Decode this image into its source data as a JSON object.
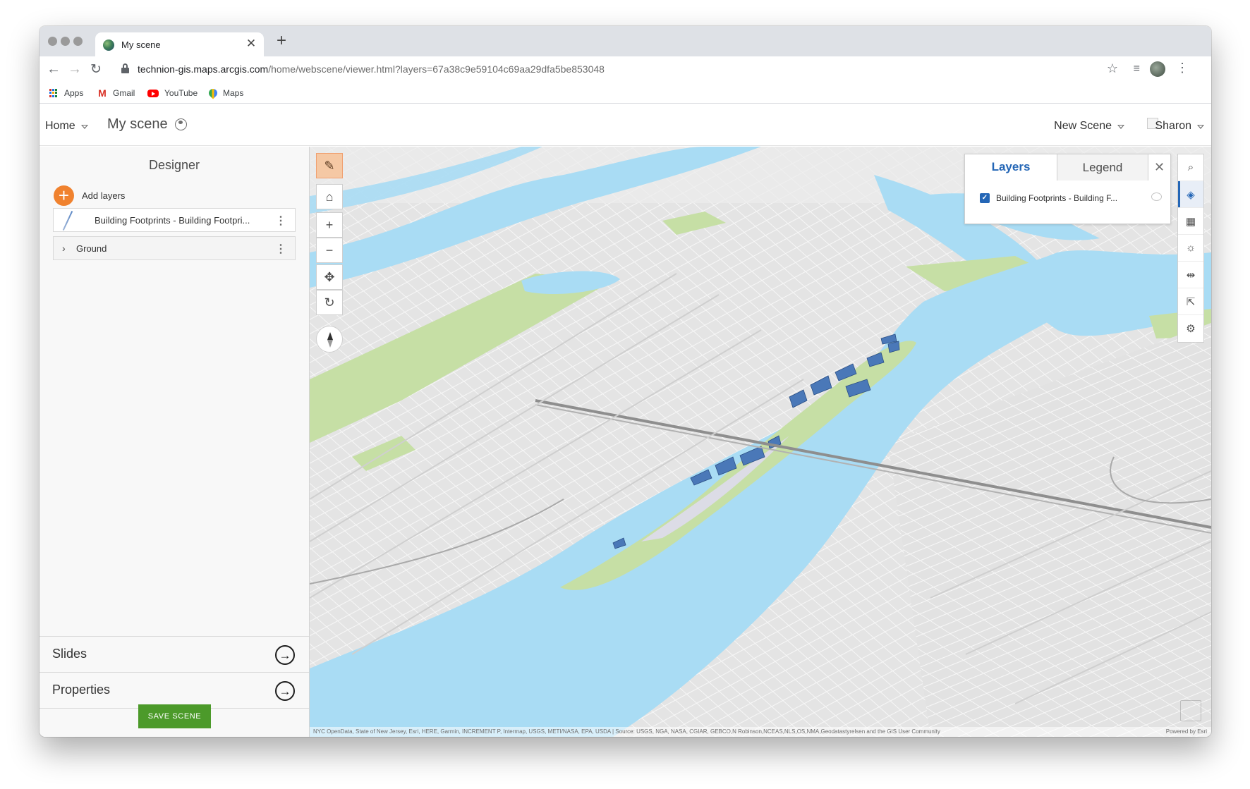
{
  "browser": {
    "tab_title": "My scene",
    "url_host": "technion-gis.maps.arcgis.com",
    "url_path": "/home/webscene/viewer.html?layers=67a38c9e59104c69aa29dfa5be853048",
    "bookmarks": [
      {
        "label": "Apps",
        "icon": "apps-grid-icon"
      },
      {
        "label": "Gmail",
        "icon": "gmail-icon"
      },
      {
        "label": "YouTube",
        "icon": "youtube-icon"
      },
      {
        "label": "Maps",
        "icon": "google-maps-icon"
      }
    ]
  },
  "header": {
    "home_label": "Home",
    "scene_title": "My scene",
    "new_scene_label": "New Scene",
    "user_name": "Sharon"
  },
  "designer": {
    "title": "Designer",
    "add_layers_label": "Add layers",
    "layers": [
      {
        "label": "Building Footprints - Building Footpri..."
      },
      {
        "label": "Ground"
      }
    ],
    "sections": [
      {
        "label": "Slides"
      },
      {
        "label": "Properties"
      }
    ],
    "save_label": "SAVE SCENE"
  },
  "map": {
    "layers_panel": {
      "tab_layers": "Layers",
      "tab_legend": "Legend",
      "item_label": "Building Footprints - Building F...",
      "item_checked": true
    },
    "attribution": "NYC OpenData, State of New Jersey, Esri, HERE, Garmin, INCREMENT P, Intermap, USGS, METI/NASA, EPA, USDA | Source: USGS, NGA, NASA, CGIAR, GEBCO,N Robinson,NCEAS,NLS,OS,NMA,Geodatastyrelsen and the GIS User Community",
    "powered_by": "Powered by Esri",
    "colors": {
      "water": "#a9dcf4",
      "land": "#e6e6e6",
      "park": "#c6dfa5",
      "buildings": "#4a78b8",
      "accent": "#f0822f"
    }
  }
}
